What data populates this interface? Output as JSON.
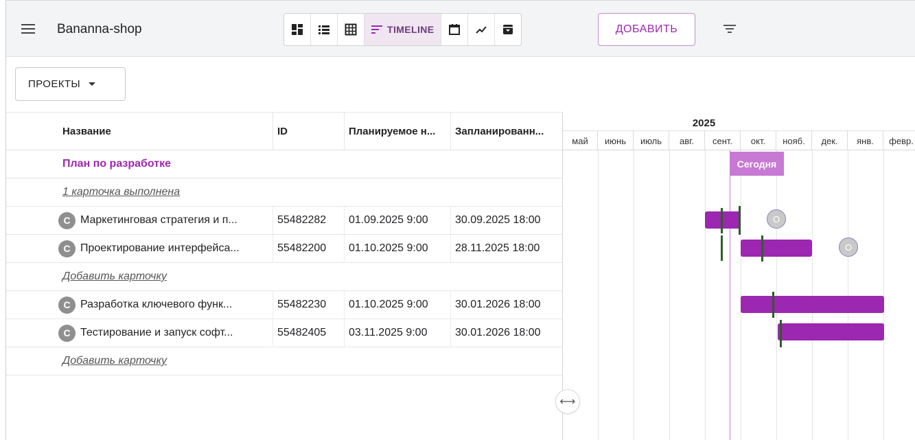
{
  "app": {
    "title": "Bananna-shop"
  },
  "toolbar": {
    "timeline_label": "TIMELINE",
    "add_label": "ДОБАВИТЬ",
    "accent_color": "#9c27b0"
  },
  "projects": {
    "label": "ПРОЕКТЫ"
  },
  "table": {
    "columns": [
      "Название",
      "ID",
      "Планируемое н...",
      "Запланированн..."
    ],
    "group_title": "План по разработке",
    "done_link": "1 карточка выполнена",
    "add_card": "Добавить карточку",
    "avatar_letter": "С",
    "rows": [
      {
        "name": "Маркетинговая стратегия и п...",
        "id": "55482282",
        "planned_start": "01.09.2025 9:00",
        "scheduled_end": "30.09.2025 18:00"
      },
      {
        "name": "Проектирование интерфейса...",
        "id": "55482200",
        "planned_start": "01.10.2025 9:00",
        "scheduled_end": "28.11.2025 18:00"
      },
      {
        "name": "Разработка ключевого функ...",
        "id": "55482230",
        "planned_start": "01.10.2025 9:00",
        "scheduled_end": "30.01.2026 18:00"
      },
      {
        "name": "Тестирование и запуск софт...",
        "id": "55482405",
        "planned_start": "03.11.2025 9:00",
        "scheduled_end": "30.01.2026 18:00"
      }
    ]
  },
  "gantt": {
    "year": "2025",
    "months": [
      "май",
      "июнь",
      "июль",
      "авг.",
      "сент.",
      "окт.",
      "нояб.",
      "дек.",
      "янв.",
      "февр."
    ],
    "today_label": "Сегодня",
    "milestone_letter": "O"
  }
}
